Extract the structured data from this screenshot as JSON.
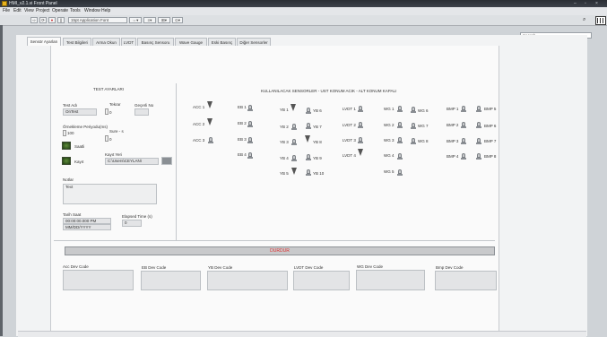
{
  "window": {
    "title": "HMI_v2.1.vi Front Panel",
    "controls": [
      "–",
      "▫",
      "×"
    ]
  },
  "menu": [
    "File",
    "Edit",
    "View",
    "Project",
    "Operate",
    "Tools",
    "Window",
    "Help"
  ],
  "toolbar": {
    "font_label": "15pt Application Font",
    "search_placeholder": "Search"
  },
  "tabs": [
    "Sensör Ayarları",
    "Test Bilgileri",
    "Arma Okun",
    "LVDT",
    "Basınç Sensoru",
    "Wave Gauge",
    "Eski Basınç",
    "Diğer Sensorler"
  ],
  "left": {
    "title": "TEST AYARLARI",
    "test_adi_label": "Test Adı",
    "test_adi_value": "OnTest",
    "tekrar_label": "Tekrar",
    "tekrar_value": "0",
    "gecerli_no_label": "Geçerli No",
    "ornek_label": "Örnekleme Periyodu(ms)",
    "ornek_value": "100",
    "sure_label": "Sure - s",
    "sure_value": "0",
    "saat_label": "Saatli",
    "kayit_label": "Kayıt",
    "kayit_yeri_label": "Kayıt Yeri",
    "kayit_yeri_value": "C:\\Users\\CEYLAN\\",
    "notlar_label": "Notlar",
    "notlar_value": "Text",
    "tarih_label": "Tarih Saat",
    "tarih_value1": "00:00:00.000 PM",
    "tarih_value2": "MM/DD/YYYY",
    "elapsed_label": "Elapsed Time (s)",
    "elapsed_value": "0"
  },
  "sensors": {
    "title": "KULLANILACAK SENSORLER - UST KONUM ACIK - ALT KONUM KAPALI",
    "acc": [
      "ACC 1",
      "ACC 2",
      "ACC 3"
    ],
    "eb": [
      "EB 1",
      "EB 2",
      "EB 3",
      "EB 4"
    ],
    "yb_left": [
      "YB 1",
      "YB 2",
      "YB 3",
      "YB 4",
      "YB 5"
    ],
    "yb_right": [
      "YB 6",
      "YB 7",
      "YB 8",
      "YB 9",
      "YB 10"
    ],
    "lvdt": [
      "LVDT 1",
      "LVDT 2",
      "LVDT 3",
      "LVDT 4"
    ],
    "wg_left": [
      "WG 1",
      "WG 2",
      "WG 3",
      "WG 4",
      "WG 5"
    ],
    "wg_right": [
      "WG 6",
      "WG 7",
      "WG 8"
    ],
    "bmp_left": [
      "BMP 1",
      "BMP 2",
      "BMP 3",
      "BMP 4"
    ],
    "bmp_right": [
      "BMP 5",
      "BMP 6",
      "BMP 7",
      "BMP 8"
    ]
  },
  "durdur": "DURDUR",
  "bottom": {
    "acc": "Acc Dev Code",
    "eb": "EB Dev Code",
    "yb": "YB Dev Code",
    "lvdt": "LVDT Dev Code",
    "wg": "WG Dev Code",
    "bmp": "Bmp Dev Code"
  }
}
